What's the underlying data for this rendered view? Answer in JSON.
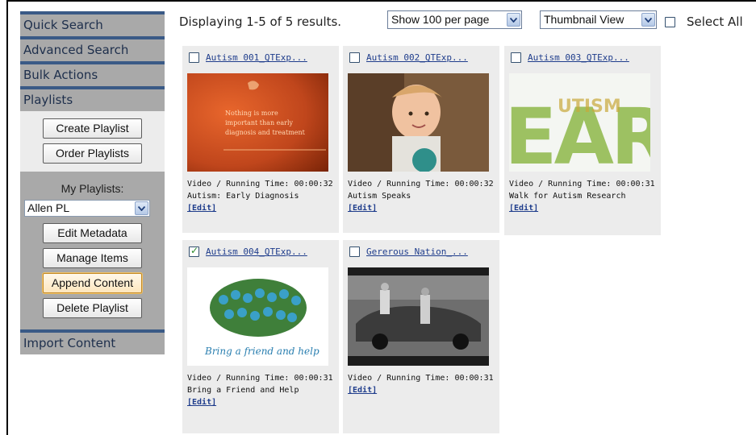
{
  "sidebar": {
    "nav": [
      "Quick Search",
      "Advanced Search",
      "Bulk Actions",
      "Playlists"
    ],
    "playlist_buttons_top": [
      "Create Playlist",
      "Order Playlists"
    ],
    "my_playlists_label": "My Playlists:",
    "selected_playlist": "Allen PL",
    "playlist_buttons_bottom": [
      "Edit Metadata",
      "Manage Items",
      "Append Content",
      "Delete Playlist"
    ],
    "import_label": "Import Content"
  },
  "toolbar": {
    "display_text": "Displaying 1-5 of 5 results.",
    "per_page": "Show 100 per page",
    "view_mode": "Thumbnail View",
    "select_all": "Select All"
  },
  "results": [
    {
      "title": "Autism 001_QTExp...",
      "running": "Video / Running Time: 00:00:32",
      "desc": "Autism: Early Diagnosis",
      "edit": "[Edit]",
      "checked": false,
      "thumb_text": [
        "Nothing is more",
        "important than early",
        "diagnosis and treatment"
      ]
    },
    {
      "title": "Autism 002_QTExp...",
      "running": "Video / Running Time: 00:00:32",
      "desc": "Autism Speaks",
      "edit": "[Edit]",
      "checked": false
    },
    {
      "title": "Autism 003_QTExp...",
      "running": "Video / Running Time: 00:00:31",
      "desc": "Walk for Autism Research",
      "edit": "[Edit]",
      "checked": false
    },
    {
      "title": "Autism 004_QTExp...",
      "running": "Video / Running Time: 00:00:31",
      "desc": "Bring a Friend and Help",
      "edit": "[Edit]",
      "checked": true,
      "thumb_text": "Bring a friend and help"
    },
    {
      "title": "Gererous Nation_...",
      "running": "Video / Running Time: 00:00:31",
      "desc": "",
      "edit": "[Edit]",
      "checked": false
    }
  ]
}
